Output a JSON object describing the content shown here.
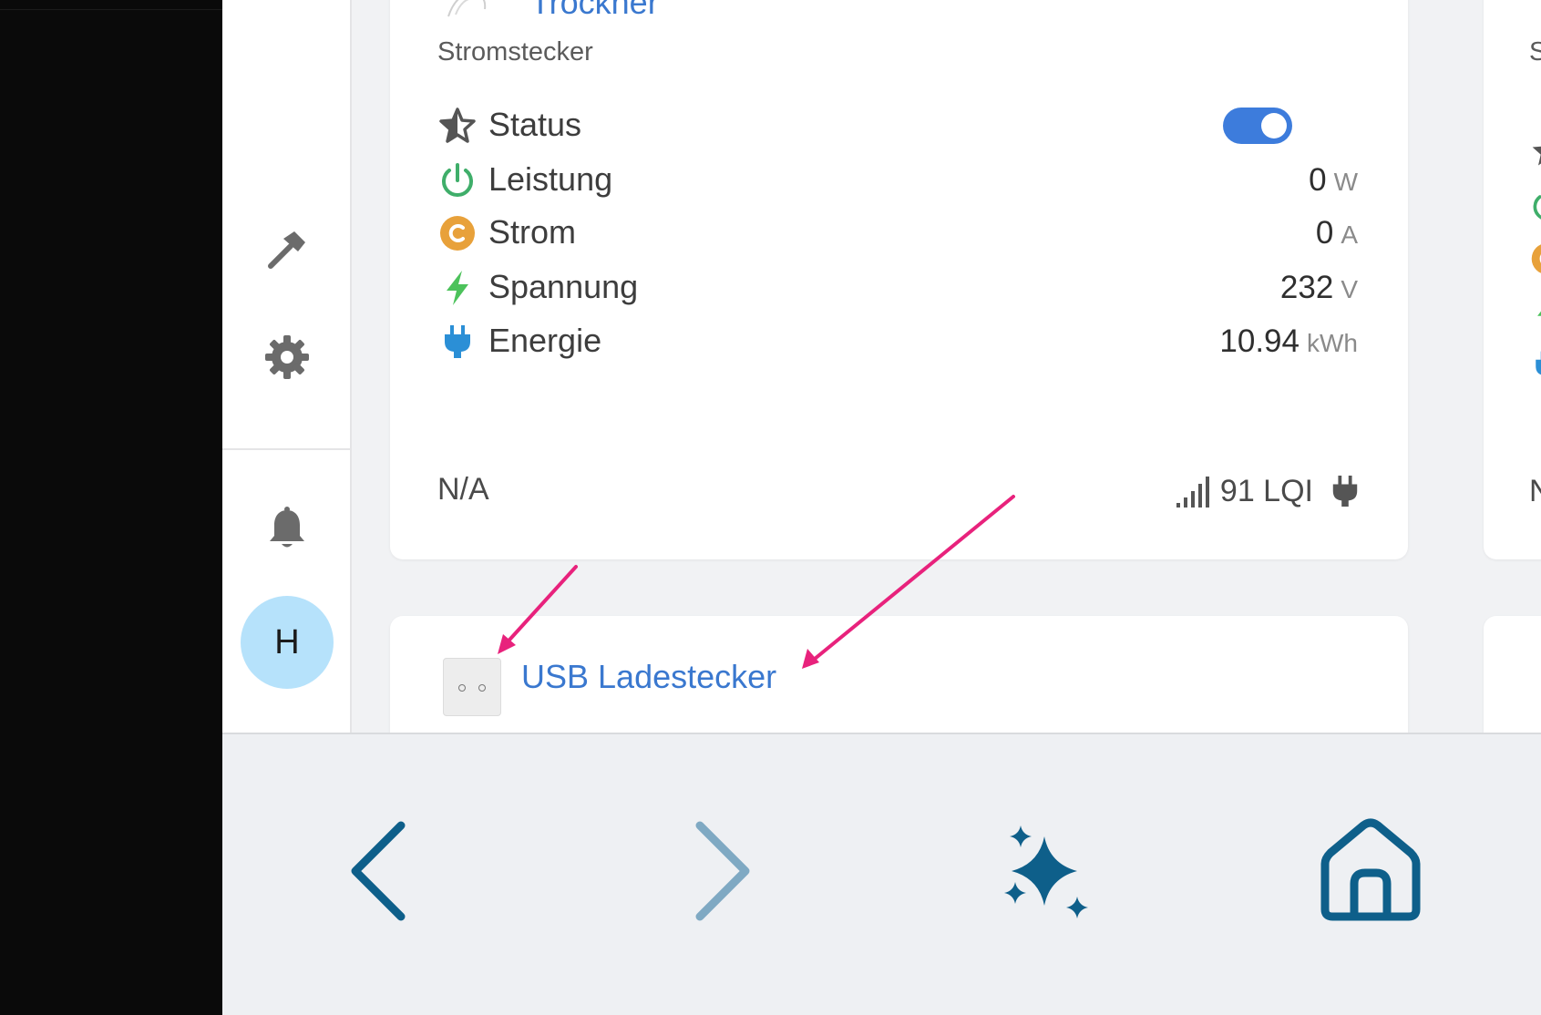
{
  "device_card": {
    "name": "Trockner",
    "subtitle": "Stromstecker",
    "rows": [
      {
        "icon": "star-outline-icon",
        "label": "Status",
        "type": "toggle",
        "on": true
      },
      {
        "icon": "power-icon",
        "label": "Leistung",
        "value": "0",
        "unit": "W"
      },
      {
        "icon": "current-c-icon",
        "label": "Strom",
        "value": "0",
        "unit": "A"
      },
      {
        "icon": "lightning-icon",
        "label": "Spannung",
        "value": "232",
        "unit": "V"
      },
      {
        "icon": "plug-icon",
        "label": "Energie",
        "value": "10.94",
        "unit": "kWh"
      }
    ],
    "footer_left": "N/A",
    "footer_lqi": "91 LQI"
  },
  "second_card": {
    "name": "USB Ladestecker"
  },
  "peek_card": {
    "subtitle": "Str",
    "footer_left": "N/"
  },
  "sidebar": {
    "avatar_initial": "H"
  },
  "colors": {
    "accent": "#3d7cdc",
    "link": "#3a78cf",
    "power_green": "#3fae6a",
    "current_orange": "#e8a13a",
    "lightning_green": "#4cc25b",
    "plug_blue": "#2b8fd6",
    "nav_blue": "#0e5f8a",
    "arrow_pink": "#e8227c"
  }
}
